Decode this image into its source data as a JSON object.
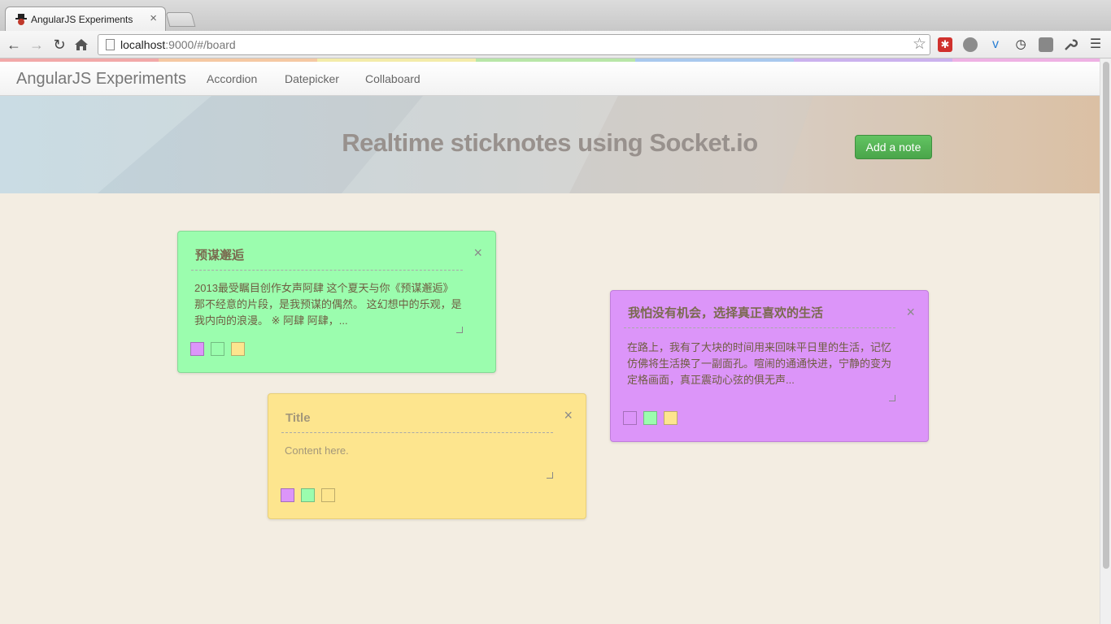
{
  "browser": {
    "tab_title": "AngularJS Experiments",
    "tab_close": "×",
    "url_host": "localhost",
    "url_rest": ":9000/#/board",
    "star_icon": "☆"
  },
  "colors": {
    "green_note": "#9bfdae",
    "yellow_note": "#fde58e",
    "purple_note": "#dc95f9",
    "button_green": "#5bb75b"
  },
  "navbar": {
    "brand": "AngularJS Experiments",
    "links": [
      "Accordion",
      "Datepicker",
      "Collaboard"
    ]
  },
  "hero": {
    "title": "Realtime sticknotes using Socket.io",
    "add_button": "Add a note"
  },
  "notes": [
    {
      "title": "预谋邂逅",
      "content": "2013最受瞩目创作女声阿肆 这个夏天与你《预谋邂逅》 那不经意的片段，是我预谋的偶然。 这幻想中的乐观，是我内向的浪漫。 ※ 阿肆 阿肆，...",
      "color": "green",
      "close": "×"
    },
    {
      "title": "Title",
      "content": "Content here.",
      "color": "yellow",
      "close": "×"
    },
    {
      "title": "我怕没有机会，选择真正喜欢的生活",
      "content": "在路上，我有了大块的时间用来回味平日里的生活，记忆仿佛将生活换了一副面孔。喧闹的通通快进，宁静的变为定格画面，真正震动心弦的俱无声...",
      "color": "purple",
      "close": "×"
    }
  ]
}
